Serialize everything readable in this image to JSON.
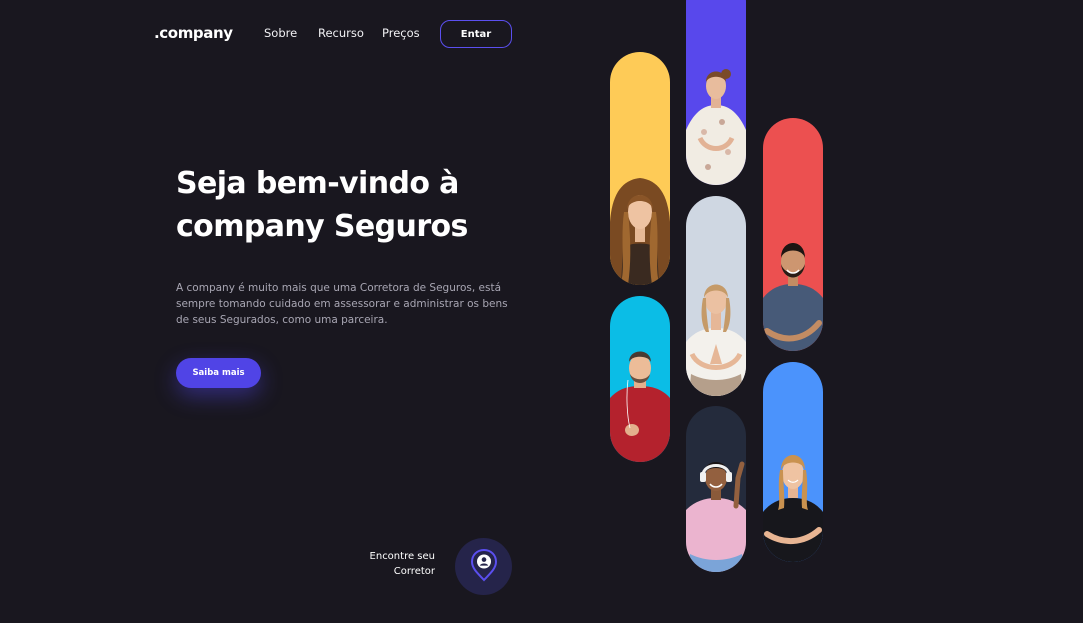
{
  "brand": {
    "logo": ".company"
  },
  "nav": {
    "links": [
      "Sobre",
      "Recurso",
      "Preços"
    ],
    "login_label": "Entar"
  },
  "hero": {
    "title_line1": "Seja bem-vindo à",
    "title_line2": "company Seguros",
    "description": "A company é muito mais que uma Corretora de Seguros, está sempre tomando cuidado em assessorar e administrar os bens de seus Segurados, como uma parceira.",
    "cta_label": "Saiba mais"
  },
  "finder": {
    "line1": "Encontre seu",
    "line2": "Corretor",
    "icon": "location-user-icon"
  },
  "gallery": {
    "pills": [
      {
        "name": "woman-long-hair",
        "color": "#fecb57"
      },
      {
        "name": "man-red-sweater",
        "color": "#0bbde6"
      },
      {
        "name": "woman-floral-dress",
        "color": "#5848ec"
      },
      {
        "name": "woman-meditating",
        "color": "#cfd7e2"
      },
      {
        "name": "woman-headphones",
        "color": "#242b3c"
      },
      {
        "name": "man-smiling",
        "color": "#ec5050"
      },
      {
        "name": "woman-blonde-smiling",
        "color": "#4b93fc"
      }
    ]
  },
  "colors": {
    "background": "#19171f",
    "accent": "#5044e6",
    "text_muted": "#a8a6b3"
  }
}
